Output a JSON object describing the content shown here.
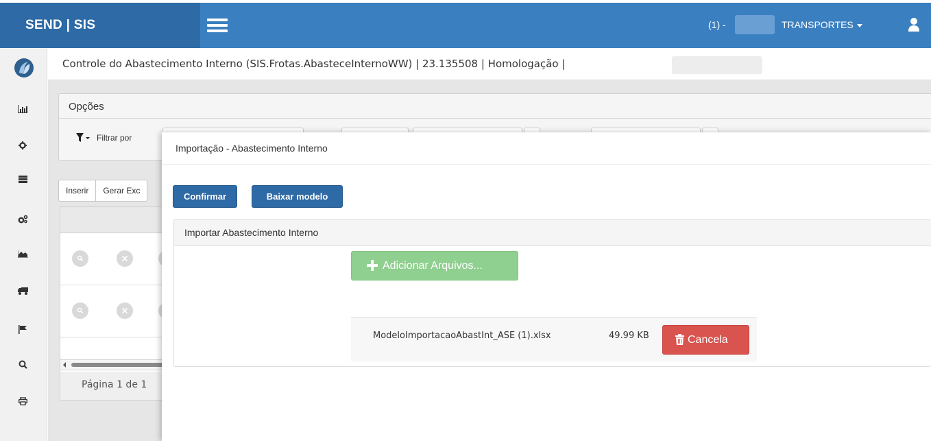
{
  "navbar": {
    "brand": "SEND | SIS",
    "user_count": "(1) -",
    "company": "TRANSPORTES",
    "colors": {
      "bar": "#3a7fc0",
      "brand_bg": "#2e6aa6"
    }
  },
  "sidebar": {
    "icons": [
      "logo-icon",
      "bar-chart-icon",
      "gear-icon",
      "list-icon",
      "gears-icon",
      "area-chart-icon",
      "truck-icon",
      "flag-icon",
      "search-icon",
      "print-icon"
    ]
  },
  "header": {
    "title": "Controle do Abastecimento Interno (SIS.Frotas.AbasteceInternoWW) | 23.135508 | Homologação |"
  },
  "background": {
    "panel_title": "Opções",
    "filter_label": "Filtrar por",
    "buttons": [
      "Inserir",
      "Gerar Exc"
    ],
    "pager": "Página 1 de 1"
  },
  "modal": {
    "title": "Importação - Abastecimento Interno",
    "confirm": "Confirmar",
    "download_template": "Baixar modelo",
    "panel_title": "Importar Abastecimento Interno",
    "add_files": "Adicionar Arquivos...",
    "file": {
      "name": "ModeloImportacaoAbastInt_ASE (1).xlsx",
      "size": "49.99 KB"
    },
    "cancel": "Cancela",
    "colors": {
      "primary": "#2e6aa6",
      "success": "#8fcf8f",
      "danger": "#d9534f"
    }
  }
}
